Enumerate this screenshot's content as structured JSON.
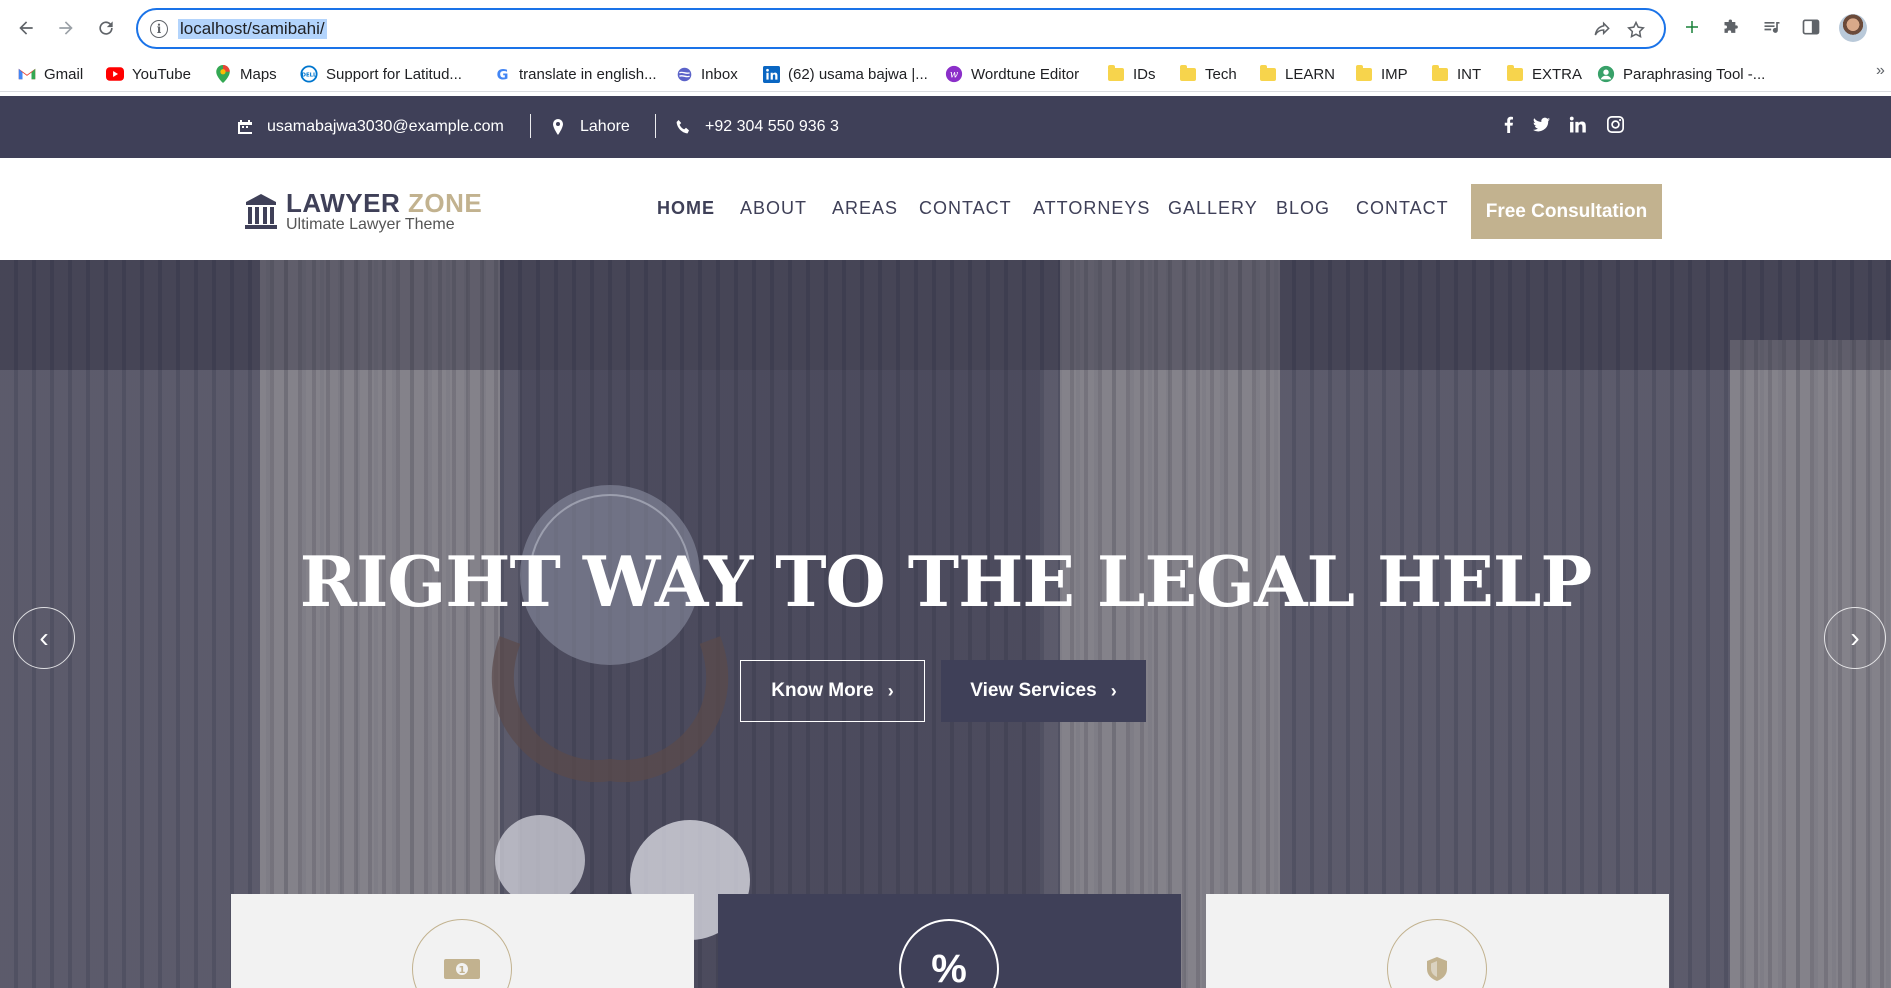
{
  "browser": {
    "url": "localhost/samibahi/",
    "bookmarks": [
      {
        "label": "Gmail",
        "icon": "gmail-icon"
      },
      {
        "label": "YouTube",
        "icon": "youtube-icon"
      },
      {
        "label": "Maps",
        "icon": "maps-icon"
      },
      {
        "label": "Support for Latitud...",
        "icon": "dell-icon"
      },
      {
        "label": "translate in english...",
        "icon": "google-icon"
      },
      {
        "label": "Inbox",
        "icon": "inbox-icon"
      },
      {
        "label": "(62) usama bajwa |...",
        "icon": "linkedin-icon"
      },
      {
        "label": "Wordtune Editor",
        "icon": "wordtune-icon"
      },
      {
        "label": "IDs",
        "icon": "folder-icon"
      },
      {
        "label": "Tech",
        "icon": "folder-icon"
      },
      {
        "label": "LEARN",
        "icon": "folder-icon"
      },
      {
        "label": "IMP",
        "icon": "folder-icon"
      },
      {
        "label": "INT",
        "icon": "folder-icon"
      },
      {
        "label": "EXTRA",
        "icon": "folder-icon"
      },
      {
        "label": "Paraphrasing Tool -...",
        "icon": "paraphrase-icon"
      }
    ]
  },
  "topbar": {
    "email": "usamabajwa3030@example.com",
    "location": "Lahore",
    "phone": "+92 304 550 936 3",
    "social": [
      "facebook-icon",
      "twitter-icon",
      "linkedin-icon",
      "instagram-icon"
    ]
  },
  "header": {
    "logo_word1": "LAWYER",
    "logo_word2": "ZONE",
    "logo_tagline": "Ultimate Lawyer Theme",
    "menu": [
      {
        "label": "HOME",
        "active": true
      },
      {
        "label": "ABOUT"
      },
      {
        "label": "AREAS"
      },
      {
        "label": "CONTACT"
      },
      {
        "label": "ATTORNEYS"
      },
      {
        "label": "GALLERY"
      },
      {
        "label": "BLOG"
      },
      {
        "label": "CONTACT"
      }
    ],
    "cta": "Free Consultation"
  },
  "hero": {
    "title": "RIGHT WAY TO THE LEGAL HELP",
    "btn_know": "Know More",
    "btn_services": "View Services",
    "cards": [
      {
        "icon": "money-icon",
        "style": "light"
      },
      {
        "icon": "percent-icon",
        "style": "dark",
        "symbol": "%"
      },
      {
        "icon": "shield-icon",
        "style": "light"
      }
    ]
  },
  "colors": {
    "navy": "#3f4058",
    "gold": "#c2b28f",
    "omnibox_focus": "#1a73e8"
  }
}
